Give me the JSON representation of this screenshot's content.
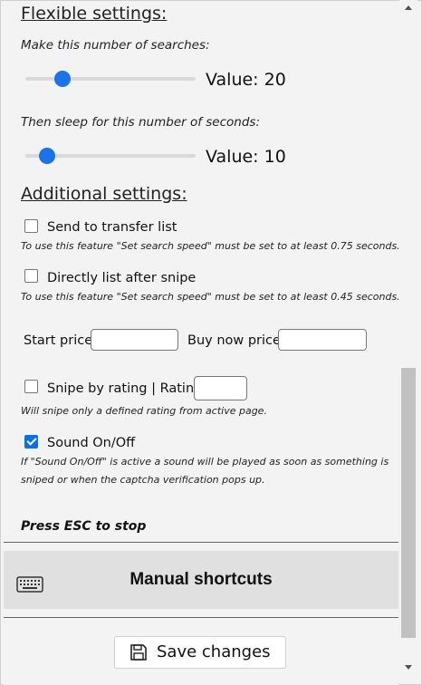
{
  "flexible": {
    "title": "Flexible settings:",
    "searches_label": "Make this number of searches:",
    "searches_value_text": "Value: 20",
    "searches_slider_fraction": 0.22,
    "sleep_label": "Then sleep for this number of seconds:",
    "sleep_value_text": "Value: 10",
    "sleep_slider_fraction": 0.13
  },
  "additional": {
    "title": "Additional settings:",
    "send_transfer": {
      "label": "Send to transfer list",
      "checked": false,
      "note": "To use this feature \"Set search speed\" must be set to at least 0.75 seconds."
    },
    "direct_list": {
      "label": "Directly list after snipe",
      "checked": false,
      "note": "To use this feature \"Set search speed\" must be set to at least 0.45 seconds."
    },
    "start_price_label": "Start price:",
    "start_price_value": "",
    "buy_now_label": "Buy now price:",
    "buy_now_value": "",
    "snipe_rating": {
      "label": "Snipe by rating | Rating:",
      "checked": false,
      "rating_value": "",
      "note": "Will snipe only a defined rating from active page."
    },
    "sound": {
      "label": "Sound On/Off",
      "checked": true,
      "note_line1": "If \"Sound On/Off\" is active a sound will be played as soon as something is",
      "note_line2": "sniped or when the captcha verification pops up."
    }
  },
  "press_esc": "Press ESC to stop",
  "shortcuts": {
    "label": "Manual shortcuts",
    "icon": "keyboard-icon"
  },
  "save": {
    "label": "Save changes",
    "icon": "floppy-disk-icon"
  },
  "colors": {
    "accent": "#1a73e8",
    "background": "#f3f3f3",
    "shortcuts_bg": "#e0e0e0"
  }
}
